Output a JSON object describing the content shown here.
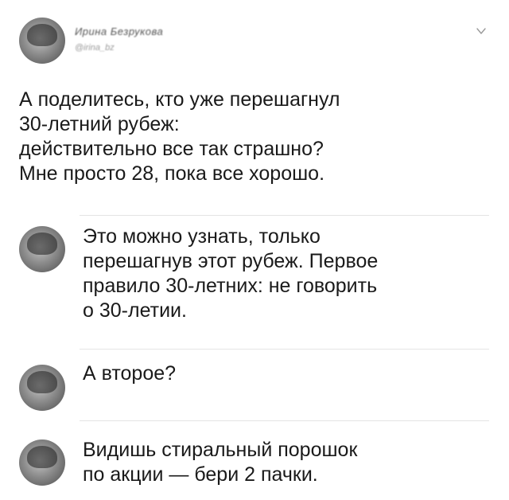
{
  "post": {
    "author_name": "Ирина Безрукова",
    "author_handle": "@irina_bz",
    "text_lines": [
      "А поделитесь, кто уже перешагнул",
      "30-летний рубеж:",
      "действительно все так страшно?",
      "Мне просто 28, пока все хорошо."
    ]
  },
  "replies": [
    {
      "lines": [
        "Это можно узнать, только",
        "перешагнув этот рубеж. Первое",
        "правило 30-летних: не говорить",
        "о 30-летии."
      ]
    },
    {
      "lines": [
        "А второе?"
      ]
    },
    {
      "lines": [
        "Видишь стиральный порошок",
        "по акции — бери 2 пачки."
      ]
    }
  ],
  "icons": {
    "menu": "chevron-down-icon"
  }
}
